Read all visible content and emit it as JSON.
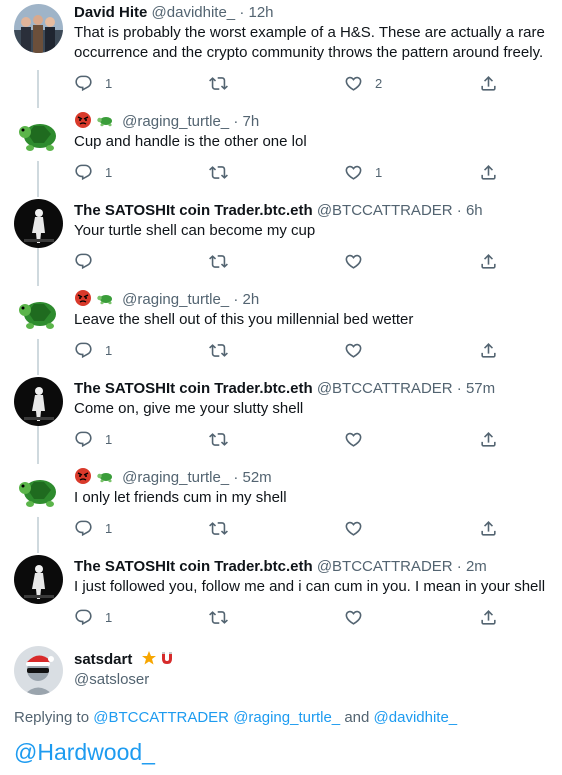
{
  "tweets": [
    {
      "name": "David Hite",
      "handle": "@davidhite_",
      "time": "· 12h",
      "text": "That is probably the worst example of a H&S. These are actually a rare occurrence and the crypto community throws the pattern around freely.",
      "reply_count": "1",
      "retweet_count": "",
      "like_count": "2",
      "avatar": "people-photo-avatar"
    },
    {
      "name": "",
      "handle": "@raging_turtle_",
      "time": "· 7h",
      "text": "Cup and handle is the other one lol",
      "reply_count": "1",
      "retweet_count": "",
      "like_count": "1",
      "avatar": "turtle-avatar"
    },
    {
      "name": "The SATOSHIt coin Trader.btc.eth",
      "handle": "@BTCCATTRADER",
      "time": "· 6h",
      "text": "Your turtle shell can become my cup",
      "reply_count": "",
      "retweet_count": "",
      "like_count": "",
      "avatar": "dark-figure-avatar"
    },
    {
      "name": "",
      "handle": "@raging_turtle_",
      "time": "· 2h",
      "text": "Leave the shell out of this you millennial bed wetter",
      "reply_count": "1",
      "retweet_count": "",
      "like_count": "",
      "avatar": "turtle-avatar"
    },
    {
      "name": "The SATOSHIt coin Trader.btc.eth",
      "handle": "@BTCCATTRADER",
      "time": "· 57m",
      "text": "Come on, give me your slutty shell",
      "reply_count": "1",
      "retweet_count": "",
      "like_count": "",
      "avatar": "dark-figure-avatar"
    },
    {
      "name": "",
      "handle": "@raging_turtle_",
      "time": "· 52m",
      "text": "I only let friends cum in my shell",
      "reply_count": "1",
      "retweet_count": "",
      "like_count": "",
      "avatar": "turtle-avatar"
    },
    {
      "name": "The SATOSHIt coin Trader.btc.eth",
      "handle": "@BTCCATTRADER",
      "time": "· 2m",
      "text": "I just followed you, follow me and i can cum in you. I mean in your shell",
      "reply_count": "1",
      "retweet_count": "",
      "like_count": "",
      "avatar": "dark-figure-avatar"
    }
  ],
  "composer": {
    "name": "satsdart",
    "handle": "@satsloser",
    "replying_prefix": "Replying to",
    "mention_1": "@BTCCATTRADER",
    "mention_2": "@raging_turtle_",
    "and_word": "and",
    "mention_3": "@davidhite_",
    "draft_text": "@Hardwood_",
    "avatar": "santa-hat-avatar"
  },
  "colors": {
    "accent": "#1d9bf0",
    "secondary_text": "#536471",
    "thread_line": "#cfd9de"
  }
}
